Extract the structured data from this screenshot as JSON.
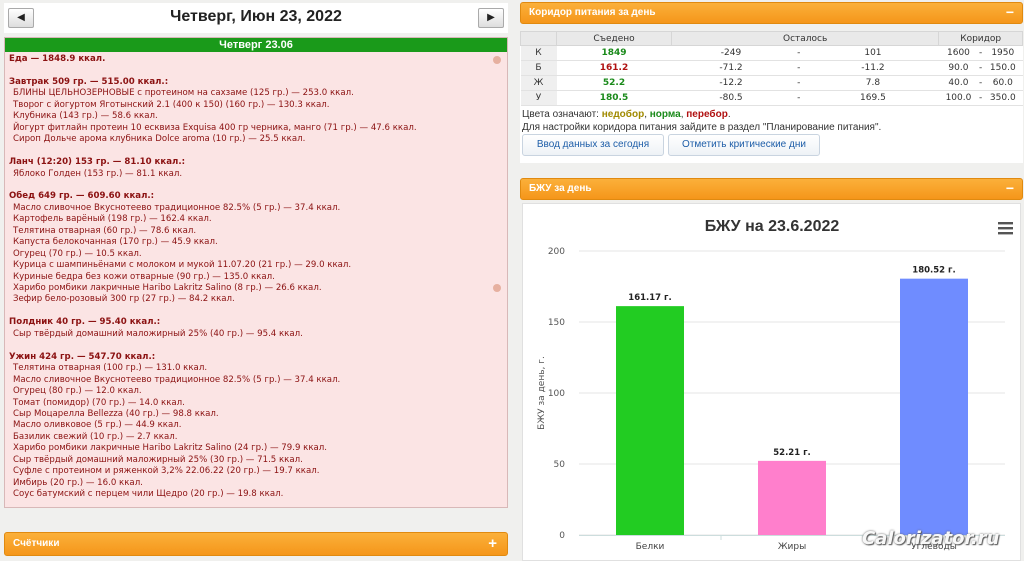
{
  "date_nav": {
    "title": "Четверг, Июн 23, 2022",
    "prev_icon": "◀",
    "next_icon": "▶"
  },
  "day": {
    "header": "Четверг 23.06",
    "total": "Еда — 1848.9 ккал.",
    "meals": [
      {
        "title": "Завтрак 509 гр. — 515.00 ккал.:",
        "items": [
          "БЛИНЫ ЦЕЛЬНОЗЕРНОВЫЕ с протеином на сахзаме (125 гр.) — 253.0 ккал.",
          "Творог с йогуртом Яготынский 2.1 (400 к 150) (160 гр.) — 130.3 ккал.",
          "Клубника (143 гр.) — 58.6 ккал.",
          "Йогурт фитлайн протеин 10 есквиза Exquisa 400 гр черника, манго (71 гр.) — 47.6 ккал.",
          "Сироп Дольче арома клубника Dolce aroma (10 гр.) — 25.5 ккал."
        ]
      },
      {
        "title": "Ланч (12:20) 153 гр. — 81.10 ккал.:",
        "items": [
          "Яблоко Голден (153 гр.) — 81.1 ккал."
        ]
      },
      {
        "title": "Обед 649 гр. — 609.60 ккал.:",
        "items": [
          "Масло сливочное Вкуснотеево традиционное 82.5% (5 гр.) — 37.4 ккал.",
          "Картофель варёный (198 гр.) — 162.4 ккал.",
          "Телятина отварная (60 гр.) — 78.6 ккал.",
          "Капуста белокочанная (170 гр.) — 45.9 ккал.",
          "Огурец (70 гр.) — 10.5 ккал.",
          "Курица с шампиньёнами с молоком и мукой 11.07.20 (21 гр.) — 29.0 ккал.",
          "Куриные бедра без кожи отварные (90 гр.) — 135.0 ккал.",
          "Харибо ромбики лакричные Haribo Lakritz Salino (8 гр.) — 26.6 ккал.",
          "Зефир бело-розовый 300 гр (27 гр.) — 84.2 ккал."
        ]
      },
      {
        "title": "Полдник 40 гр. — 95.40 ккал.:",
        "items": [
          "Сыр твёрдый домашний маложирный 25% (40 гр.) — 95.4 ккал."
        ]
      },
      {
        "title": "Ужин 424 гр. — 547.70 ккал.:",
        "items": [
          "Телятина отварная (100 гр.) — 131.0 ккал.",
          "Масло сливочное Вкуснотеево традиционное 82.5% (5 гр.) — 37.4 ккал.",
          "Огурец (80 гр.) — 12.0 ккал.",
          "Томат (помидор) (70 гр.) — 14.0 ккал.",
          "Сыр Моцарелла Bellezza (40 гр.) — 98.8 ккал.",
          "Масло оливковое (5 гр.) — 44.9 ккал.",
          "Базилик свежий (10 гр.) — 2.7 ккал.",
          "Харибо ромбики лакричные Haribo Lakritz Salino (24 гр.) — 79.9 ккал.",
          "Сыр твёрдый домашний маложирный 25% (30 гр.) — 71.5 ккал.",
          "Суфле с протеином и ряженкой 3,2% 22.06.22 (20 гр.) — 19.7 ккал.",
          "Имбирь (20 гр.) — 16.0 ккал.",
          "Соус батумский с перцем чили Щедро (20 гр.) — 19.8 ккал."
        ]
      }
    ]
  },
  "counters": {
    "title": "Счётчики",
    "icon": "+"
  },
  "corridor_panel": {
    "title": "Коридор питания за день",
    "min_icon": "−",
    "headers": [
      "Съедено",
      "Осталось",
      "Коридор"
    ],
    "rows": [
      {
        "label": "К",
        "eaten": "1849",
        "color": "#1a8a1a",
        "left_min": "-249",
        "sep": "-",
        "left_max": "101",
        "cor_min": "1600",
        "sep2": "-",
        "cor_max": "1950"
      },
      {
        "label": "Б",
        "eaten": "161.2",
        "color": "#b01010",
        "left_min": "-71.2",
        "sep": "-",
        "left_max": "-11.2",
        "cor_min": "90.0",
        "sep2": "-",
        "cor_max": "150.0"
      },
      {
        "label": "Ж",
        "eaten": "52.2",
        "color": "#1a8a1a",
        "left_min": "-12.2",
        "sep": "-",
        "left_max": "7.8",
        "cor_min": "40.0",
        "sep2": "-",
        "cor_max": "60.0"
      },
      {
        "label": "У",
        "eaten": "180.5",
        "color": "#1a8a1a",
        "left_min": "-80.5",
        "sep": "-",
        "left_max": "169.5",
        "cor_min": "100.0",
        "sep2": "-",
        "cor_max": "350.0"
      }
    ],
    "legend_prefix": "Цвета означают: ",
    "legend_under": "недобор",
    "legend_norm": "норма",
    "legend_over": "перебор",
    "legend_end": ".",
    "hint": "Для настройки коридора питания зайдите в раздел \"Планирование питания\".",
    "btn_input": "Ввод данных за сегодня",
    "btn_critical": "Отметить критические дни"
  },
  "bju_panel": {
    "title": "БЖУ за день",
    "min_icon": "−",
    "menu_icon": "hamburger-icon"
  },
  "chart_data": {
    "type": "bar",
    "title": "БЖУ на 23.6.2022",
    "ylabel": "БЖУ за день, г.",
    "xlabel": "",
    "categories": [
      "Белки",
      "Жиры",
      "Углеводы"
    ],
    "values": [
      161.17,
      52.21,
      180.52
    ],
    "data_labels": [
      "161.17 г.",
      "52.21 г.",
      "180.52 г."
    ],
    "colors": [
      "#22cc22",
      "#ff7fcc",
      "#6f8cff"
    ],
    "ylim": [
      0,
      200
    ],
    "yticks": [
      0,
      50,
      100,
      150,
      200
    ],
    "grid": true
  },
  "watermark": "Calorizator.ru"
}
